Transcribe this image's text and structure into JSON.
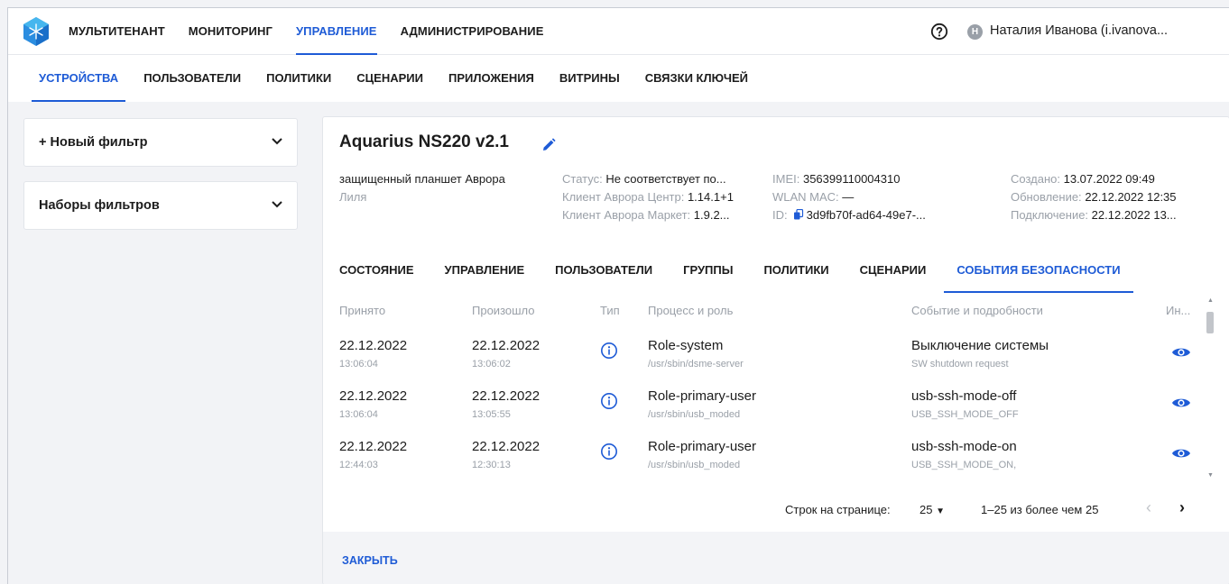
{
  "topnav": {
    "items": [
      "МУЛЬТИТЕНАНТ",
      "МОНИТОРИНГ",
      "УПРАВЛЕНИЕ",
      "АДМИНИСТРИРОВАНИЕ"
    ],
    "active_index": 2,
    "user_initial": "Н",
    "user_name": "Наталия Иванова (i.ivanova..."
  },
  "subnav": {
    "items": [
      "УСТРОЙСТВА",
      "ПОЛЬЗОВАТЕЛИ",
      "ПОЛИТИКИ",
      "СЦЕНАРИИ",
      "ПРИЛОЖЕНИЯ",
      "ВИТРИНЫ",
      "СВЯЗКИ КЛЮЧЕЙ"
    ],
    "active_index": 0
  },
  "filters": {
    "new_filter": "+ Новый фильтр",
    "filter_sets": "Наборы фильтров"
  },
  "device": {
    "title": "Aquarius NS220 v2.1",
    "type": "защищенный планшет Аврора",
    "owner": "Лиля",
    "status_label": "Статус:",
    "status_value": "Не соответствует по...",
    "client_center_label": "Клиент Аврора Центр:",
    "client_center_value": "1.14.1+1",
    "client_market_label": "Клиент Аврора Маркет:",
    "client_market_value": "1.9.2...",
    "imei_label": "IMEI:",
    "imei_value": "356399110004310",
    "wlan_label": "WLAN MAC:",
    "wlan_value": "—",
    "id_label": "ID:",
    "id_value": "3d9fb70f-ad64-49e7-...",
    "created_label": "Создано:",
    "created_value": "13.07.2022 09:49",
    "updated_label": "Обновление:",
    "updated_value": "22.12.2022 12:35",
    "connected_label": "Подключение:",
    "connected_value": "22.12.2022 13..."
  },
  "tabs": {
    "items": [
      "СОСТОЯНИЕ",
      "УПРАВЛЕНИЕ",
      "ПОЛЬЗОВАТЕЛИ",
      "ГРУППЫ",
      "ПОЛИТИКИ",
      "СЦЕНАРИИ",
      "СОБЫТИЯ БЕЗОПАСНОСТИ"
    ],
    "active_index": 6
  },
  "table": {
    "headers": {
      "received": "Принято",
      "occurred": "Произошло",
      "type": "Тип",
      "process": "Процесс и роль",
      "event": "Событие и подробности",
      "info": "Ин..."
    },
    "rows": [
      {
        "received_date": "22.12.2022",
        "received_time": "13:06:04",
        "occurred_date": "22.12.2022",
        "occurred_time": "13:06:02",
        "role": "Role-system",
        "process": "/usr/sbin/dsme-server",
        "event": "Выключение системы",
        "details": "SW shutdown request"
      },
      {
        "received_date": "22.12.2022",
        "received_time": "13:06:04",
        "occurred_date": "22.12.2022",
        "occurred_time": "13:05:55",
        "role": "Role-primary-user",
        "process": "/usr/sbin/usb_moded",
        "event": "usb-ssh-mode-off",
        "details": "USB_SSH_MODE_OFF"
      },
      {
        "received_date": "22.12.2022",
        "received_time": "12:44:03",
        "occurred_date": "22.12.2022",
        "occurred_time": "12:30:13",
        "role": "Role-primary-user",
        "process": "/usr/sbin/usb_moded",
        "event": "usb-ssh-mode-on",
        "details": "USB_SSH_MODE_ON,"
      }
    ]
  },
  "pagination": {
    "rows_label": "Строк на странице:",
    "rows_value": "25",
    "range": "1–25 из более чем 25"
  },
  "footer": {
    "close_label": "ЗАКРЫТЬ"
  },
  "colors": {
    "accent": "#1e5bd6",
    "muted": "#9aa0a8"
  }
}
